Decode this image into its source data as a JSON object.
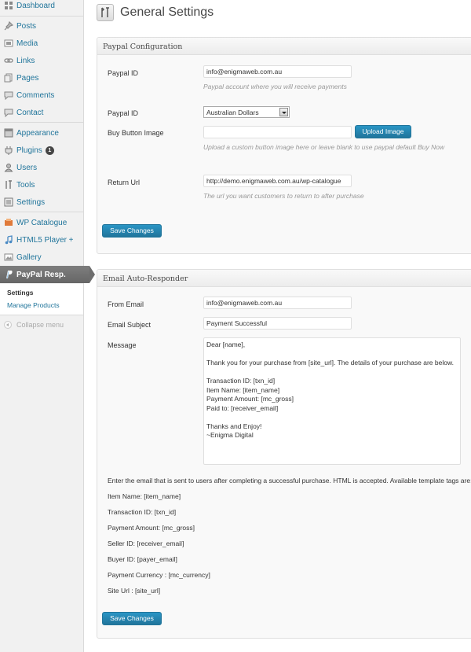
{
  "sidebar": {
    "items": [
      {
        "label": "Dashboard",
        "icon": "dashboard-icon"
      },
      {
        "label": "Posts",
        "icon": "pin-icon"
      },
      {
        "label": "Media",
        "icon": "media-icon"
      },
      {
        "label": "Links",
        "icon": "link-icon"
      },
      {
        "label": "Pages",
        "icon": "pages-icon"
      },
      {
        "label": "Comments",
        "icon": "comment-icon"
      },
      {
        "label": "Contact",
        "icon": "contact-icon"
      },
      {
        "label": "Appearance",
        "icon": "appearance-icon"
      },
      {
        "label": "Plugins",
        "icon": "plugin-icon",
        "badge": "1"
      },
      {
        "label": "Users",
        "icon": "users-icon"
      },
      {
        "label": "Tools",
        "icon": "tools-icon"
      },
      {
        "label": "Settings",
        "icon": "settings-icon"
      },
      {
        "label": "WP Catalogue",
        "icon": "catalogue-icon"
      },
      {
        "label": "HTML5 Player +",
        "icon": "music-note-icon"
      },
      {
        "label": "Gallery",
        "icon": "gallery-icon"
      },
      {
        "label": "PayPal Resp.",
        "icon": "paypal-icon"
      }
    ],
    "submenu": [
      "Settings",
      "Manage Products"
    ],
    "collapse_label": "Collapse menu"
  },
  "page": {
    "title": "General Settings"
  },
  "paypal": {
    "heading": "Paypal Configuration",
    "paypal_id_label": "Paypal ID",
    "paypal_id_value": "info@enigmaweb.com.au",
    "paypal_id_desc": "Paypal account where you will receive payments",
    "currency_label": "Paypal ID",
    "currency_value": "Australian Dollars",
    "buy_button_label": "Buy Button Image",
    "buy_button_value": "",
    "upload_button": "Upload Image",
    "buy_button_desc": "Upload a custom button image here or leave blank to use paypal default Buy Now",
    "return_url_label": "Return Url",
    "return_url_value": "http://demo.enigmaweb.com.au/wp-catalogue",
    "return_url_desc": "The url you want customers to return to after purchase",
    "save_button": "Save Changes"
  },
  "email": {
    "heading": "Email Auto-Responder",
    "from_label": "From Email",
    "from_value": "info@enigmaweb.com.au",
    "subject_label": "Email Subject",
    "subject_value": "Payment Successful",
    "message_label": "Message",
    "message_value": "Dear [name],\n\nThank you for your purchase from [site_url]. The details of your purchase are below.\n\nTransaction ID: [txn_id]\nItem Name: [item_name]\nPayment Amount: [mc_gross]\nPaid to: [receiver_email]\n\nThanks and Enjoy!\n~Enigma Digital",
    "help_text": "Enter the email that is sent to users after completing a successful purchase. HTML is accepted. Available template tags are:",
    "tags": [
      "Item Name: [item_name]",
      "Transaction ID: [txn_id]",
      "Payment Amount: [mc_gross]",
      "Seller ID: [receiver_email]",
      "Buyer ID: [payer_email]",
      "Payment Currency : [mc_currency]",
      "Site Url : [site_url]"
    ],
    "save_button": "Save Changes"
  },
  "colors": {
    "link": "#21759b",
    "button": "#21759b",
    "active_menu": "#6e6e6e"
  }
}
